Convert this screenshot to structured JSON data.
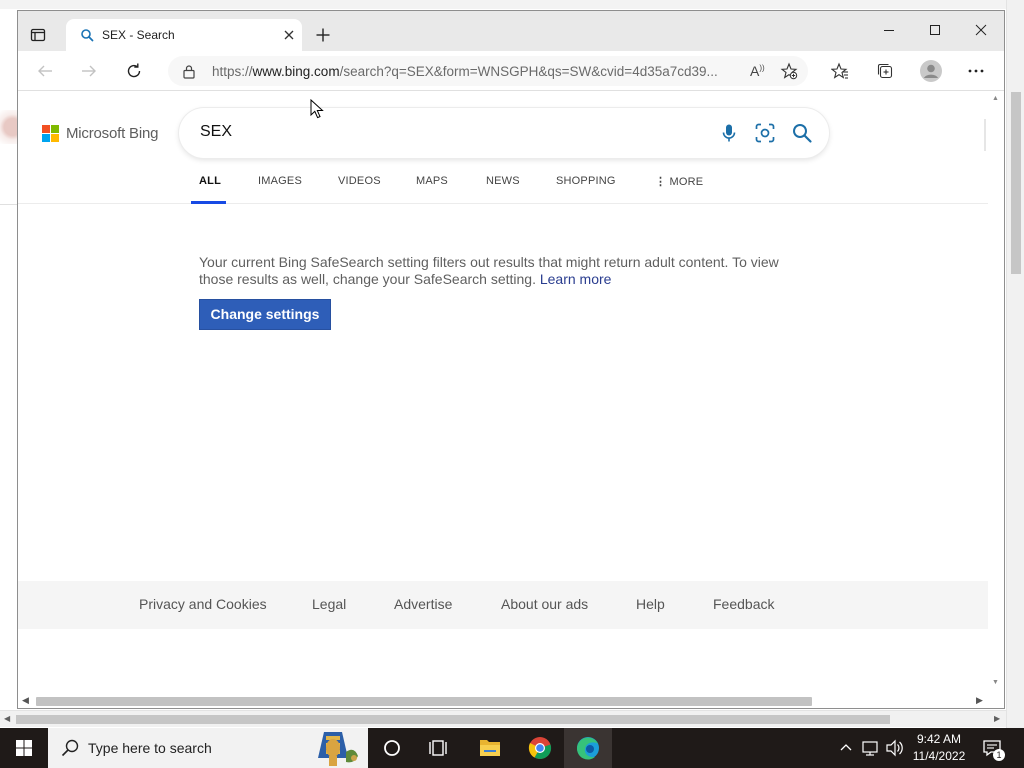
{
  "browser": {
    "tab_title": "SEX - Search",
    "url_prefix": "https://",
    "url_host": "www.bing.com",
    "url_rest": "/search?q=SEX&form=WNSGPH&qs=SW&cvid=4d35a7cd39..."
  },
  "bing": {
    "logo_text": "Microsoft Bing",
    "query": "SEX",
    "scopes": [
      "ALL",
      "IMAGES",
      "VIDEOS",
      "MAPS",
      "NEWS",
      "SHOPPING",
      "MORE"
    ],
    "active_scope": "ALL",
    "notice_text": "Your current Bing SafeSearch setting filters out results that might return adult content. To view those results as well, change your SafeSearch setting. ",
    "learn_more": "Learn more",
    "change_settings": "Change settings",
    "footer_links": [
      "Privacy and Cookies",
      "Legal",
      "Advertise",
      "About our ads",
      "Help",
      "Feedback"
    ]
  },
  "taskbar": {
    "search_placeholder": "Type here to search",
    "time": "9:42 AM",
    "date": "11/4/2022",
    "notification_count": "1"
  },
  "colors": {
    "accent": "#174ae4",
    "button": "#2e5eb8",
    "link": "#2a3d8f",
    "taskbar": "#1f1a18"
  },
  "icons": [
    "tab-actions-icon",
    "bing-favicon-icon",
    "close-icon",
    "plus-icon",
    "minimize-icon",
    "maximize-icon",
    "back-icon",
    "forward-icon",
    "refresh-icon",
    "lock-icon",
    "read-aloud-icon",
    "add-favorite-icon",
    "favorites-icon",
    "collections-icon",
    "profile-icon",
    "more-icon",
    "microphone-icon",
    "visual-search-icon",
    "search-icon",
    "windows-start-icon",
    "cortana-icon",
    "task-view-icon",
    "file-explorer-icon",
    "chrome-icon",
    "edge-icon",
    "chevron-up-icon",
    "network-icon",
    "volume-icon",
    "notifications-icon"
  ]
}
